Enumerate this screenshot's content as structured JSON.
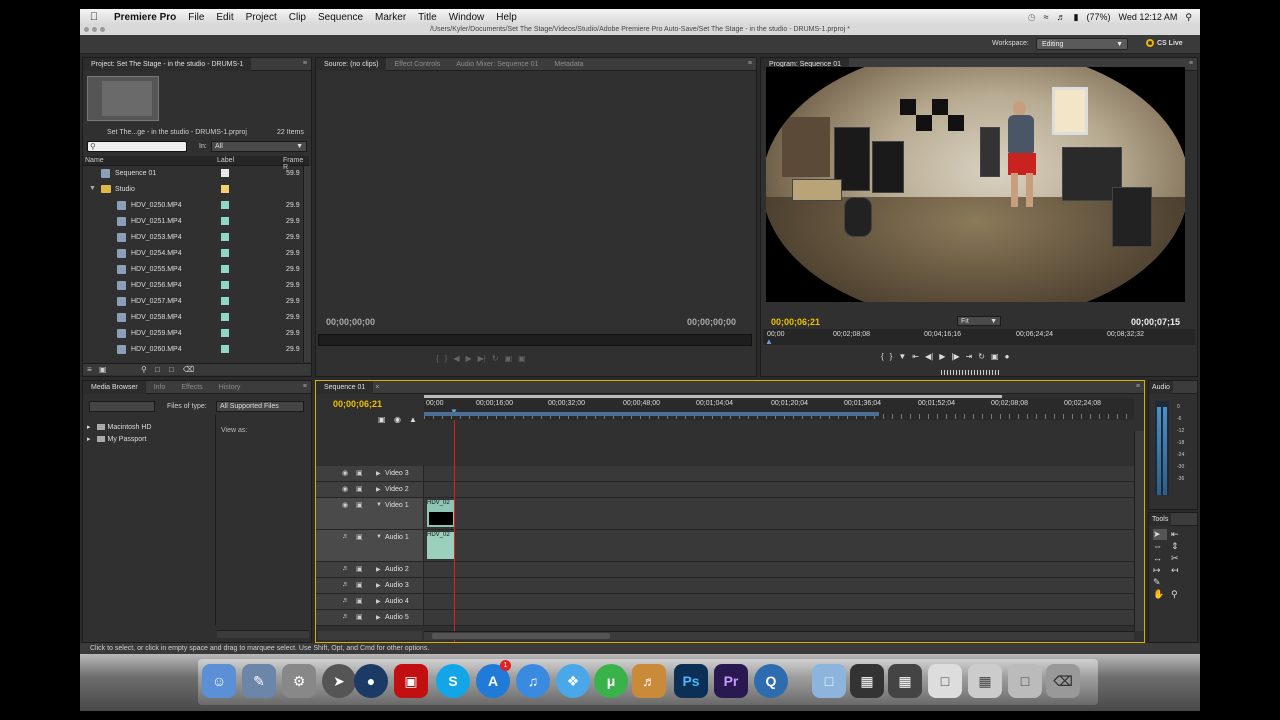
{
  "menubar": {
    "app": "Premiere Pro",
    "items": [
      "File",
      "Edit",
      "Project",
      "Clip",
      "Sequence",
      "Marker",
      "Title",
      "Window",
      "Help"
    ],
    "battery": "(77%)",
    "clock": "Wed 12:12 AM"
  },
  "titlebar": {
    "path": "/Users/Kyler/Documents/Set The Stage/Videos/Studio/Adobe Premiere Pro Auto-Save/Set The Stage - in the studio - DRUMS-1.prproj *"
  },
  "workspace": {
    "label": "Workspace:",
    "value": "Editing",
    "cs_live": "CS Live"
  },
  "project": {
    "tab": "Project: Set The Stage - in the studio - DRUMS-1",
    "filename": "Set The...ge - in the studio - DRUMS-1.prproj",
    "count": "22 Items",
    "in_label": "In:",
    "in_value": "All",
    "columns": {
      "name": "Name",
      "label": "Label",
      "frame": "Frame R"
    },
    "items": [
      {
        "name": "Sequence 01",
        "fr": "59.9",
        "color": "#e8e8e8"
      },
      {
        "name": "Studio",
        "fr": "",
        "color": "#f2d36b"
      },
      {
        "name": "HDV_0250.MP4",
        "fr": "29.9",
        "color": "#8fd6c4"
      },
      {
        "name": "HDV_0251.MP4",
        "fr": "29.9",
        "color": "#8fd6c4"
      },
      {
        "name": "HDV_0253.MP4",
        "fr": "29.9",
        "color": "#8fd6c4"
      },
      {
        "name": "HDV_0254.MP4",
        "fr": "29.9",
        "color": "#8fd6c4"
      },
      {
        "name": "HDV_0255.MP4",
        "fr": "29.9",
        "color": "#8fd6c4"
      },
      {
        "name": "HDV_0256.MP4",
        "fr": "29.9",
        "color": "#8fd6c4"
      },
      {
        "name": "HDV_0257.MP4",
        "fr": "29.9",
        "color": "#8fd6c4"
      },
      {
        "name": "HDV_0258.MP4",
        "fr": "29.9",
        "color": "#8fd6c4"
      },
      {
        "name": "HDV_0259.MP4",
        "fr": "29.9",
        "color": "#8fd6c4"
      },
      {
        "name": "HDV_0260.MP4",
        "fr": "29.9",
        "color": "#8fd6c4"
      }
    ]
  },
  "source": {
    "tabs": [
      "Source: (no clips)",
      "Effect Controls",
      "Audio Mixer: Sequence 01",
      "Metadata"
    ],
    "tc_left": "00;00;00;00",
    "tc_right": "00;00;00;00"
  },
  "program": {
    "tab": "Program: Sequence 01",
    "tc_current": "00;00;06;21",
    "zoom": "Fit",
    "tc_duration": "00;00;07;15",
    "ruler": [
      "00;00",
      "00;02;08;08",
      "00;04;16;16",
      "00;06;24;24",
      "00;08;32;32"
    ]
  },
  "mediabrowser": {
    "tabs": [
      "Media Browser",
      "Info",
      "Effects",
      "History"
    ],
    "files_of_type_label": "Files of type:",
    "files_of_type": "All Supported Files",
    "drives": [
      "Macintosh HD",
      "My Passport"
    ],
    "view_as": "View as:"
  },
  "timeline": {
    "tab": "Sequence 01",
    "tc": "00;00;06;21",
    "ruler": [
      "00;00",
      "00;00;16;00",
      "00;00;32;00",
      "00;00;48;00",
      "00;01;04;04",
      "00;01;20;04",
      "00;01;36;04",
      "00;01;52;04",
      "00;02;08;08",
      "00;02;24;08"
    ],
    "tracks": {
      "video3": "Video 3",
      "video2": "Video 2",
      "video1": "Video 1",
      "audio1": "Audio 1",
      "audio2": "Audio 2",
      "audio3": "Audio 3",
      "audio4": "Audio 4",
      "audio5": "Audio 5"
    },
    "clip_label": "HDV_02"
  },
  "audio": {
    "tab": "Audio",
    "scale": [
      "0",
      "-6",
      "-12",
      "-18",
      "-24",
      "-30",
      "-36"
    ]
  },
  "tools": {
    "tab": "Tools"
  },
  "status": "Click to select, or click in empty space and drag to marquee select. Use Shift, Opt, and Cmd for other options.",
  "dock": {
    "ps": "Ps",
    "pr": "Pr",
    "badge": "1"
  },
  "colors": {
    "accent_yellow": "#f0c000",
    "playhead": "#e02020",
    "clip": "#8fc5b5"
  }
}
